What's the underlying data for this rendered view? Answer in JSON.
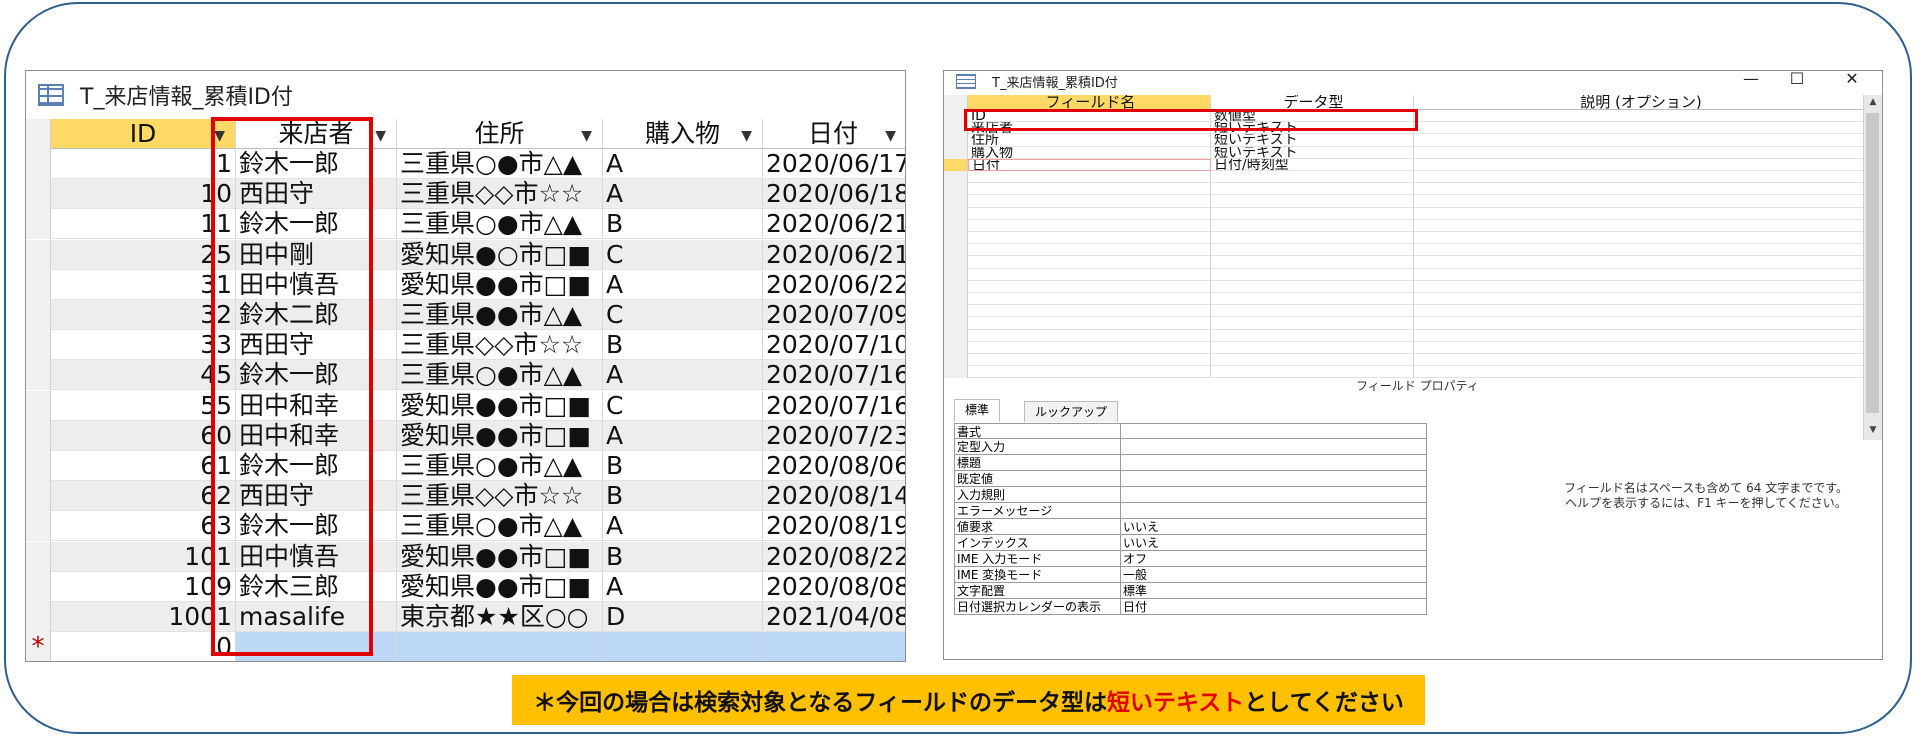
{
  "datasheet": {
    "title": "T_来店情報_累積ID付",
    "columns": [
      "ID",
      "来店者",
      "住所",
      "購入物",
      "日付"
    ],
    "rows": [
      [
        "1",
        "鈴木一郎",
        "三重県○●市△▲",
        "A",
        "2020/06/17"
      ],
      [
        "10",
        "西田守",
        "三重県◇◇市☆☆",
        "A",
        "2020/06/18"
      ],
      [
        "11",
        "鈴木一郎",
        "三重県○●市△▲",
        "B",
        "2020/06/21"
      ],
      [
        "25",
        "田中剛",
        "愛知県●○市□■",
        "C",
        "2020/06/21"
      ],
      [
        "31",
        "田中慎吾",
        "愛知県●●市□■",
        "A",
        "2020/06/22"
      ],
      [
        "32",
        "鈴木二郎",
        "三重県●●市△▲",
        "C",
        "2020/07/09"
      ],
      [
        "33",
        "西田守",
        "三重県◇◇市☆☆",
        "B",
        "2020/07/10"
      ],
      [
        "45",
        "鈴木一郎",
        "三重県○●市△▲",
        "A",
        "2020/07/16"
      ],
      [
        "55",
        "田中和幸",
        "愛知県●●市□■",
        "C",
        "2020/07/16"
      ],
      [
        "60",
        "田中和幸",
        "愛知県●●市□■",
        "A",
        "2020/07/23"
      ],
      [
        "61",
        "鈴木一郎",
        "三重県○●市△▲",
        "B",
        "2020/08/06"
      ],
      [
        "62",
        "西田守",
        "三重県◇◇市☆☆",
        "B",
        "2020/08/14"
      ],
      [
        "63",
        "鈴木一郎",
        "三重県○●市△▲",
        "A",
        "2020/08/19"
      ],
      [
        "101",
        "田中慎吾",
        "愛知県●●市□■",
        "B",
        "2020/08/22"
      ],
      [
        "109",
        "鈴木三郎",
        "愛知県●●市□■",
        "A",
        "2020/08/08"
      ],
      [
        "1001",
        "masalife",
        "東京都★★区○○",
        "D",
        "2021/04/08"
      ]
    ],
    "new_row": {
      "marker": "*",
      "id": "0"
    }
  },
  "design": {
    "title": "T_来店情報_累積ID付",
    "window_buttons": {
      "minimize": "—",
      "maximize": "☐",
      "close": "✕"
    },
    "headers": {
      "field_name": "フィールド名",
      "data_type": "データ型",
      "description": "説明 (オプション)"
    },
    "fields": [
      {
        "name": "ID",
        "type": "数値型"
      },
      {
        "name": "来店者",
        "type": "短いテキスト"
      },
      {
        "name": "住所",
        "type": "短いテキスト"
      },
      {
        "name": "購入物",
        "type": "短いテキスト"
      },
      {
        "name": "日付",
        "type": "日付/時刻型"
      }
    ],
    "field_properties_label": "フィールド プロパティ",
    "tabs": [
      "標準",
      "ルックアップ"
    ],
    "properties": [
      {
        "name": "書式",
        "value": ""
      },
      {
        "name": "定型入力",
        "value": ""
      },
      {
        "name": "標題",
        "value": ""
      },
      {
        "name": "既定値",
        "value": ""
      },
      {
        "name": "入力規則",
        "value": ""
      },
      {
        "name": "エラーメッセージ",
        "value": ""
      },
      {
        "name": "値要求",
        "value": "いいえ"
      },
      {
        "name": "インデックス",
        "value": "いいえ"
      },
      {
        "name": "IME 入力モード",
        "value": "オフ"
      },
      {
        "name": "IME 変換モード",
        "value": "一般"
      },
      {
        "name": "文字配置",
        "value": "標準"
      },
      {
        "name": "日付選択カレンダーの表示",
        "value": "日付"
      }
    ],
    "help_line1": "フィールド名はスペースも含めて 64 文字までです。",
    "help_line2": "ヘルプを表示するには、F1 キーを押してください。"
  },
  "note": {
    "prefix": "＊今回の場合は検索対象となるフィールドのデータ型は",
    "highlight": "短いテキスト",
    "suffix": "としてください"
  },
  "colors": {
    "highlight_red": "#e00000",
    "note_bg": "#ffc000",
    "header_yellow": "#ffd966",
    "new_row_blue": "#bdd7f7"
  }
}
